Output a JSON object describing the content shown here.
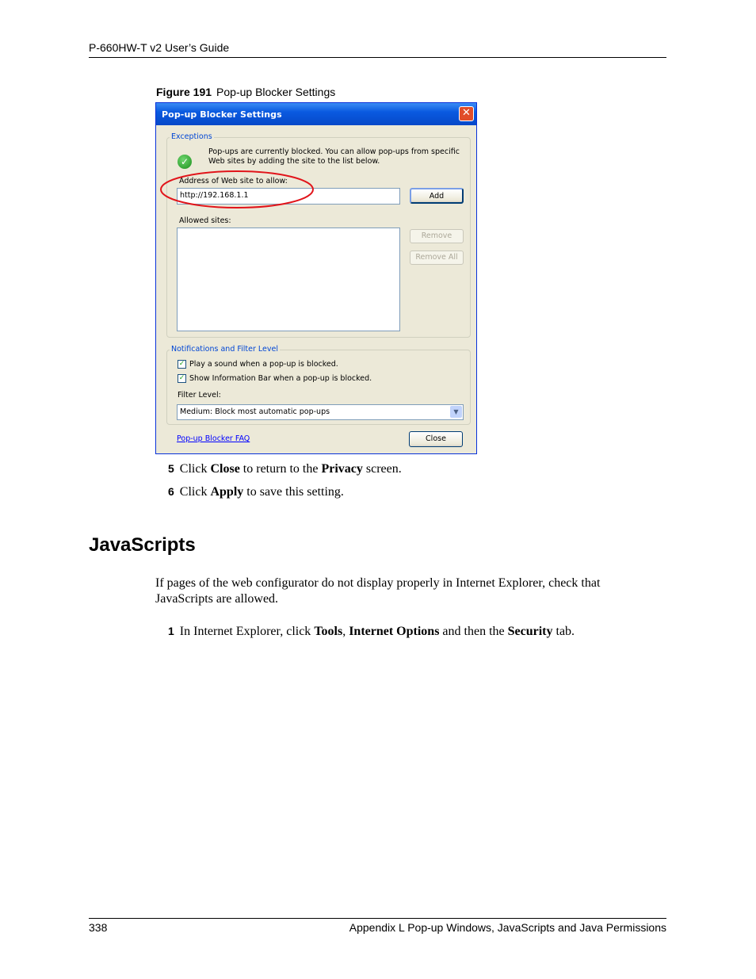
{
  "header": {
    "title": "P-660HW-T v2 User’s Guide"
  },
  "figure": {
    "label": "Figure 191",
    "caption": "Pop-up Blocker Settings"
  },
  "dialog": {
    "title": "Pop-up Blocker Settings",
    "exceptions": {
      "legend": "Exceptions",
      "info_line1": "Pop-ups are currently blocked.  You can allow pop-ups from specific",
      "info_line2": "Web sites by adding the site to the list below.",
      "address_label": "Address of Web site to allow:",
      "address_value": "http://192.168.1.1",
      "add_button": "Add",
      "allowed_label": "Allowed sites:",
      "remove_button": "Remove",
      "remove_all_button": "Remove All"
    },
    "notifications": {
      "legend": "Notifications and Filter Level",
      "play_sound": "Play a sound when a pop-up is blocked.",
      "show_info_bar": "Show Information Bar when a pop-up is blocked.",
      "filter_label": "Filter Level:",
      "filter_value": "Medium: Block most automatic pop-ups"
    },
    "faq_link": "Pop-up Blocker FAQ",
    "close_button": "Close"
  },
  "steps": {
    "s5": {
      "num": "5",
      "a": "Click ",
      "b": "Close",
      "c": " to return to the ",
      "d": "Privacy",
      "e": " screen."
    },
    "s6": {
      "num": "6",
      "a": "Click ",
      "b": "Apply",
      "c": " to save this setting."
    },
    "s1": {
      "num": "1",
      "a": "In Internet Explorer, click ",
      "b": "Tools",
      "c": ", ",
      "d": "Internet Options",
      "e": " and then the ",
      "f": "Security",
      "g": " tab."
    }
  },
  "section": {
    "heading": "JavaScripts",
    "paragraph": "If pages of the web configurator do not display properly in Internet Explorer, check that JavaScripts are allowed."
  },
  "footer": {
    "page_number": "338",
    "chapter": "Appendix L Pop-up Windows, JavaScripts and Java Permissions"
  }
}
